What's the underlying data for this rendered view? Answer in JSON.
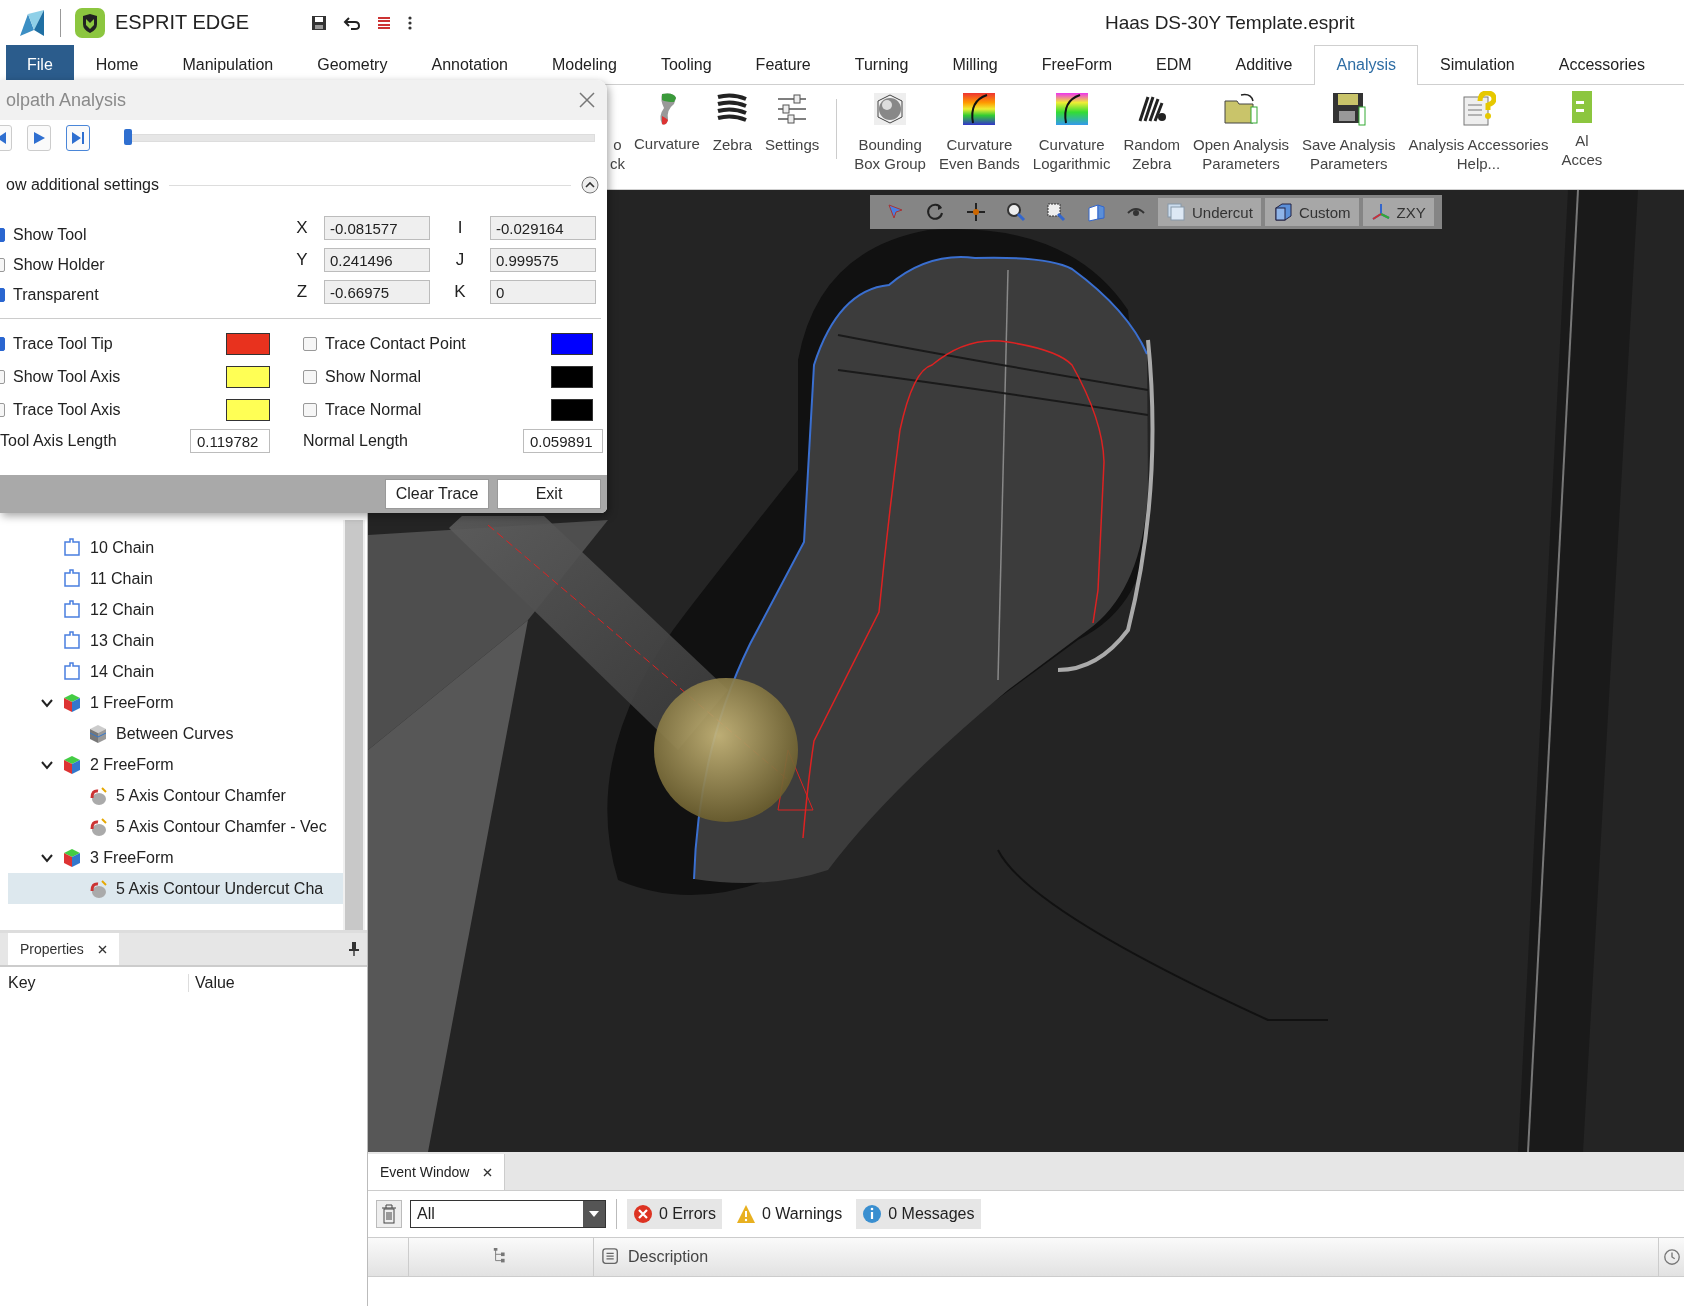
{
  "app": {
    "product": "ESPRIT EDGE",
    "document_title": "Haas DS-30Y Template.esprit"
  },
  "ribbon_tabs": [
    {
      "label": "File",
      "kind": "file",
      "selected": false
    },
    {
      "label": "Home",
      "kind": "tab",
      "selected": false
    },
    {
      "label": "Manipulation",
      "kind": "tab",
      "selected": false
    },
    {
      "label": "Geometry",
      "kind": "tab",
      "selected": false
    },
    {
      "label": "Annotation",
      "kind": "tab",
      "selected": false
    },
    {
      "label": "Modeling",
      "kind": "tab",
      "selected": false
    },
    {
      "label": "Tooling",
      "kind": "tab",
      "selected": false
    },
    {
      "label": "Feature",
      "kind": "tab",
      "selected": false
    },
    {
      "label": "Turning",
      "kind": "tab",
      "selected": false
    },
    {
      "label": "Milling",
      "kind": "tab",
      "selected": false
    },
    {
      "label": "FreeForm",
      "kind": "tab",
      "selected": false
    },
    {
      "label": "EDM",
      "kind": "tab",
      "selected": false
    },
    {
      "label": "Additive",
      "kind": "tab",
      "selected": false
    },
    {
      "label": "Analysis",
      "kind": "tab",
      "selected": true
    },
    {
      "label": "Simulation",
      "kind": "tab",
      "selected": false
    },
    {
      "label": "Accessories",
      "kind": "tab",
      "selected": false
    }
  ],
  "ribbon_items": [
    {
      "lines": [
        "o",
        "ck"
      ],
      "kind": "partial"
    },
    {
      "lines": [
        "Curvature"
      ],
      "kind": "curvature"
    },
    {
      "lines": [
        "Zebra"
      ],
      "kind": "zebra"
    },
    {
      "lines": [
        "Settings"
      ],
      "kind": "settings"
    },
    {
      "lines": [
        "Bounding",
        "Box Group"
      ],
      "kind": "bounding"
    },
    {
      "lines": [
        "Curvature",
        "Even Bands"
      ],
      "kind": "rainbow"
    },
    {
      "lines": [
        "Curvature",
        "Logarithmic"
      ],
      "kind": "rainbow-log"
    },
    {
      "lines": [
        "Random",
        "Zebra"
      ],
      "kind": "random-zebra"
    },
    {
      "lines": [
        "Open Analysis",
        "Parameters"
      ],
      "kind": "open"
    },
    {
      "lines": [
        "Save Analysis",
        "Parameters"
      ],
      "kind": "save"
    },
    {
      "lines": [
        "Analysis Accessories",
        "Help..."
      ],
      "kind": "help"
    },
    {
      "lines": [
        "Al",
        "Acces"
      ],
      "kind": "edge"
    }
  ],
  "toolpath_dialog": {
    "title": "olpath Analysis",
    "playback_buttons": [
      {
        "kind": "previous",
        "selected": false
      },
      {
        "kind": "play",
        "selected": false
      },
      {
        "kind": "end",
        "selected": true
      }
    ],
    "position": {
      "level": 0.0
    },
    "section_label": "ow additional settings",
    "expanded": true,
    "display_options": [
      {
        "label": "Show Tool",
        "checked": true
      },
      {
        "label": "Show Holder",
        "checked": false
      },
      {
        "label": "Transparent",
        "checked": true
      }
    ],
    "coordinates": [
      {
        "label": "X",
        "value": "-0.081577"
      },
      {
        "label": "Y",
        "value": "0.241496"
      },
      {
        "label": "Z",
        "value": "-0.66975"
      }
    ],
    "vector": [
      {
        "label": "I",
        "value": "-0.029164"
      },
      {
        "label": "J",
        "value": "0.999575"
      },
      {
        "label": "K",
        "value": "0"
      }
    ],
    "trace_options": [
      {
        "label": "Trace Tool Tip",
        "checked": true,
        "color": "#e8321e"
      },
      {
        "label": "Show Tool Axis",
        "checked": false,
        "color": "#ffff55"
      },
      {
        "label": "Trace Tool Axis",
        "checked": false,
        "color": "#ffff55"
      }
    ],
    "normal_options": [
      {
        "label": "Trace Contact Point",
        "checked": false,
        "color": "#0000ff"
      },
      {
        "label": "Show Normal",
        "checked": false,
        "color": "#000000"
      },
      {
        "label": "Trace Normal",
        "checked": false,
        "color": "#000000"
      }
    ],
    "tool_axis_length": {
      "label": "Tool Axis Length",
      "value": "0.119782"
    },
    "normal_length": {
      "label": "Normal Length",
      "value": "0.059891"
    },
    "buttons": [
      "Clear Trace",
      "Exit"
    ]
  },
  "tree": {
    "items": [
      {
        "label": "10 Chain",
        "kind": "chain",
        "selected": false
      },
      {
        "label": "11 Chain",
        "kind": "chain",
        "selected": false
      },
      {
        "label": "12 Chain",
        "kind": "chain",
        "selected": false
      },
      {
        "label": "13 Chain",
        "kind": "chain",
        "selected": false
      },
      {
        "label": "14 Chain",
        "kind": "chain",
        "selected": false
      },
      {
        "label": "1 FreeForm",
        "kind": "freeform",
        "selected": false,
        "expanded": true,
        "children": [
          {
            "label": "Between Curves",
            "kind": "surface",
            "selected": false
          }
        ]
      },
      {
        "label": "2 FreeForm",
        "kind": "freeform",
        "selected": false,
        "expanded": true,
        "children": [
          {
            "label": "5 Axis Contour Chamfer",
            "kind": "operation",
            "selected": false
          },
          {
            "label": "5 Axis Contour Chamfer - Vec",
            "kind": "operation",
            "selected": false
          }
        ]
      },
      {
        "label": "3 FreeForm",
        "kind": "freeform",
        "selected": false,
        "expanded": true,
        "children": [
          {
            "label": "5 Axis Contour Undercut Cha",
            "kind": "operation",
            "selected": true
          }
        ]
      }
    ]
  },
  "properties_panel": {
    "tab": "Properties",
    "columns": [
      "Key",
      "Value"
    ]
  },
  "view_toolbar": [
    {
      "kind": "select"
    },
    {
      "kind": "rotate"
    },
    {
      "kind": "pan"
    },
    {
      "kind": "zoom"
    },
    {
      "kind": "zoom-window"
    },
    {
      "kind": "cube"
    },
    {
      "kind": "eye"
    },
    {
      "kind": "undercut",
      "label": "Undercut"
    },
    {
      "kind": "custom",
      "label": "Custom"
    },
    {
      "kind": "axes",
      "label": "ZXY"
    }
  ],
  "event_window": {
    "tab": "Event Window",
    "filter": "All",
    "counters": [
      {
        "kind": "error",
        "label": "0 Errors"
      },
      {
        "kind": "warning",
        "label": "0 Warnings"
      },
      {
        "kind": "info",
        "label": "0 Messages"
      }
    ],
    "columns": [
      {
        "kind": "tree"
      },
      {
        "kind": "description",
        "label": "Description"
      },
      {
        "kind": "time"
      }
    ]
  }
}
